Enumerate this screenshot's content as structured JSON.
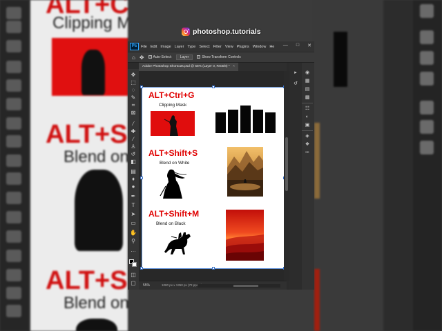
{
  "overlay": {
    "instagram_handle": "photoshop.tutorials"
  },
  "background": {
    "title_1": "ALT+Ctrl+G",
    "sub_1": "Clipping Mask",
    "title_2": "ALT+Shift+S",
    "sub_2": "Blend on White",
    "title_3": "ALT+Shift+M",
    "sub_3": "Blend on Black"
  },
  "menubar": {
    "logo": "Ps",
    "items": [
      "File",
      "Edit",
      "Image",
      "Layer",
      "Type",
      "Select",
      "Filter",
      "View",
      "Plugins",
      "Window",
      "He"
    ],
    "window_controls": [
      "—",
      "□",
      "✕"
    ]
  },
  "options_bar": {
    "auto_select_label": "Auto-Select:",
    "auto_select_value": "Layer",
    "transform_controls_label": "Show Transform Controls"
  },
  "document_tab": {
    "title": "Adobe Photoshop Shortcuts.psd @ 55% (Layer 0, RGB/8) *",
    "close": "×"
  },
  "document": {
    "sections": [
      {
        "title": "ALT+Ctrl+G",
        "subtitle": "Clipping Mask"
      },
      {
        "title": "ALT+Shift+S",
        "subtitle": "Blend on White"
      },
      {
        "title": "ALT+Shift+M",
        "subtitle": "Blend on Black"
      }
    ]
  },
  "status_bar": {
    "zoom": "55%",
    "doc_size": "1080 px x 1350 px (72 ppcm)"
  },
  "colors": {
    "accent_red": "#e00000",
    "selection_blue": "#3a72c8",
    "ps_blue": "#31a8ff"
  },
  "icons": {
    "toolbar": [
      "move-icon",
      "marquee-icon",
      "lasso-icon",
      "quick-select-icon",
      "crop-icon",
      "frame-icon",
      "eyedropper-icon",
      "healing-icon",
      "brush-icon",
      "stamp-icon",
      "history-brush-icon",
      "eraser-icon",
      "gradient-icon",
      "blur-icon",
      "dodge-icon",
      "pen-icon",
      "type-icon",
      "path-select-icon",
      "rectangle-icon",
      "hand-icon",
      "zoom-icon",
      "more-tools-icon"
    ]
  }
}
